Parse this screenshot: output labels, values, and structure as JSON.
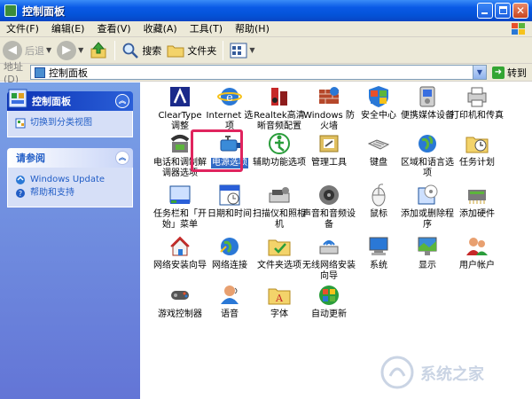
{
  "window": {
    "title": "控制面板"
  },
  "menu": [
    "文件(F)",
    "编辑(E)",
    "查看(V)",
    "收藏(A)",
    "工具(T)",
    "帮助(H)"
  ],
  "toolbar": {
    "back": "后退",
    "search": "搜索",
    "folders": "文件夹"
  },
  "address": {
    "label": "地址(D)",
    "value": "控制面板",
    "go": "转到"
  },
  "taskpane": {
    "cp_title": "控制面板",
    "cp_link": "切换到分类视图",
    "see_also_title": "请参阅",
    "links": [
      "Windows Update",
      "帮助和支持"
    ]
  },
  "items": [
    {
      "label": "ClearType 调整",
      "icon": "cleartype-icon"
    },
    {
      "label": "Internet 选项",
      "icon": "internet-options-icon"
    },
    {
      "label": "Realtek高清晰音频配置",
      "icon": "audio-icon"
    },
    {
      "label": "Windows 防火墙",
      "icon": "firewall-icon"
    },
    {
      "label": "安全中心",
      "icon": "shield-icon"
    },
    {
      "label": "便携媒体设备",
      "icon": "media-device-icon"
    },
    {
      "label": "打印机和传真",
      "icon": "printer-icon"
    },
    {
      "label": "电话和调制解调器选项",
      "icon": "phone-icon"
    },
    {
      "label": "电源选项",
      "icon": "power-icon",
      "selected": true
    },
    {
      "label": "辅助功能选项",
      "icon": "accessibility-icon"
    },
    {
      "label": "管理工具",
      "icon": "admin-tools-icon"
    },
    {
      "label": "键盘",
      "icon": "keyboard-icon"
    },
    {
      "label": "区域和语言选项",
      "icon": "globe-icon"
    },
    {
      "label": "任务计划",
      "icon": "scheduled-tasks-icon"
    },
    {
      "label": "任务栏和「开始」菜单",
      "icon": "taskbar-icon"
    },
    {
      "label": "日期和时间",
      "icon": "clock-icon"
    },
    {
      "label": "扫描仪和照相机",
      "icon": "scanner-icon"
    },
    {
      "label": "声音和音频设备",
      "icon": "speaker-icon"
    },
    {
      "label": "鼠标",
      "icon": "mouse-icon"
    },
    {
      "label": "添加或删除程序",
      "icon": "add-remove-icon"
    },
    {
      "label": "添加硬件",
      "icon": "hardware-icon"
    },
    {
      "label": "网络安装向导",
      "icon": "network-wizard-icon"
    },
    {
      "label": "网络连接",
      "icon": "network-icon"
    },
    {
      "label": "文件夹选项",
      "icon": "folder-options-icon"
    },
    {
      "label": "无线网络安装向导",
      "icon": "wireless-icon"
    },
    {
      "label": "系统",
      "icon": "system-icon"
    },
    {
      "label": "显示",
      "icon": "display-icon"
    },
    {
      "label": "用户帐户",
      "icon": "users-icon"
    },
    {
      "label": "游戏控制器",
      "icon": "gamepad-icon"
    },
    {
      "label": "语音",
      "icon": "speech-icon"
    },
    {
      "label": "字体",
      "icon": "fonts-icon"
    },
    {
      "label": "自动更新",
      "icon": "update-icon"
    }
  ],
  "watermark": "系统之家",
  "colors": {
    "titlebar": "#0453d8",
    "taskpane": "#6b8ee0",
    "selection": "#316ac5",
    "highlight": "#e0245e"
  }
}
